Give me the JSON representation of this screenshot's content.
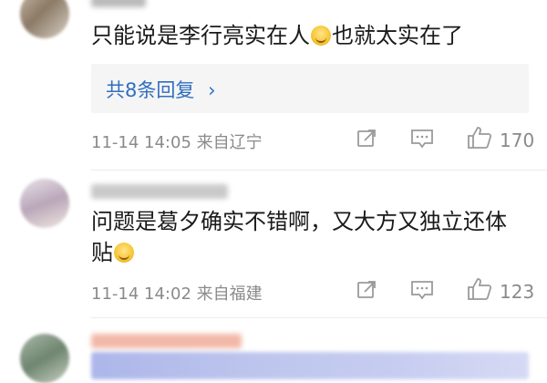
{
  "comments": [
    {
      "text": "只能说是李行亮实在人",
      "text_after_emoji": "也就太实在了",
      "emoji": "laughing-emoji",
      "reply_label": "共8条回复",
      "reply_chevron": "›",
      "meta": "11-14 14:05 来自辽宁",
      "likes": "170"
    },
    {
      "text_line1": "问题是葛夕确实不错啊，又大方又独立还体",
      "text_line2": "贴",
      "emoji": "laughing-emoji",
      "meta": "11-14 14:02 来自福建",
      "likes": "123"
    }
  ],
  "icons": {
    "share": "share-icon",
    "comment": "comment-icon",
    "like": "thumbs-up-icon"
  },
  "colors": {
    "link": "#2f6fbf",
    "meta": "#8a8a8a",
    "reply_bg": "#f5f5f5"
  }
}
